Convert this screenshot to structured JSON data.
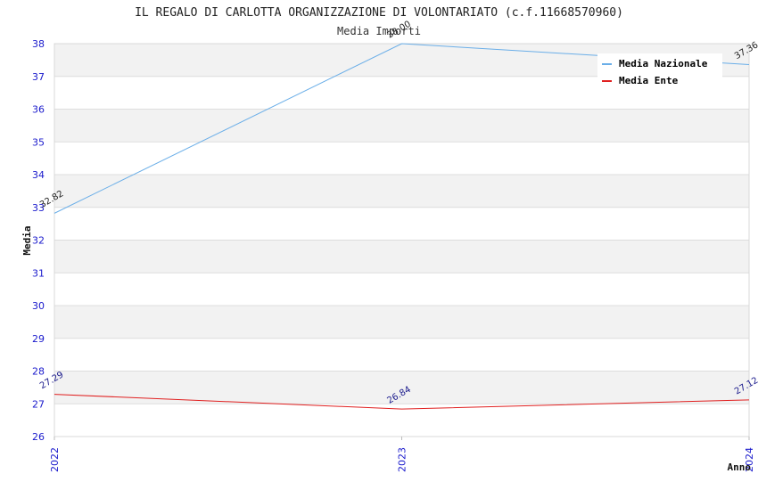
{
  "chart_data": {
    "type": "line",
    "title": "IL REGALO DI CARLOTTA ORGANIZZAZIONE DI VOLONTARIATO (c.f.11668570960)",
    "subtitle": "Media Importi",
    "xlabel": "Anno",
    "ylabel": "Media",
    "x": [
      "2022",
      "2023",
      "2024"
    ],
    "ylim": [
      26,
      38
    ],
    "yticks": [
      26,
      27,
      28,
      29,
      30,
      31,
      32,
      33,
      34,
      35,
      36,
      37,
      38
    ],
    "grid": "horizontal bands",
    "legend_position": "top-right",
    "series": [
      {
        "name": "Media Nazionale",
        "values": [
          32.82,
          38.0,
          37.36
        ],
        "labels": [
          "32.82",
          "38.00",
          "37.36"
        ],
        "color": "#6aaee8",
        "label_color": "#222222"
      },
      {
        "name": "Media Ente",
        "values": [
          27.29,
          26.84,
          27.12
        ],
        "labels": [
          "27.29",
          "26.84",
          "27.12"
        ],
        "color": "#e02020",
        "label_color": "#1a1a8c"
      }
    ]
  }
}
